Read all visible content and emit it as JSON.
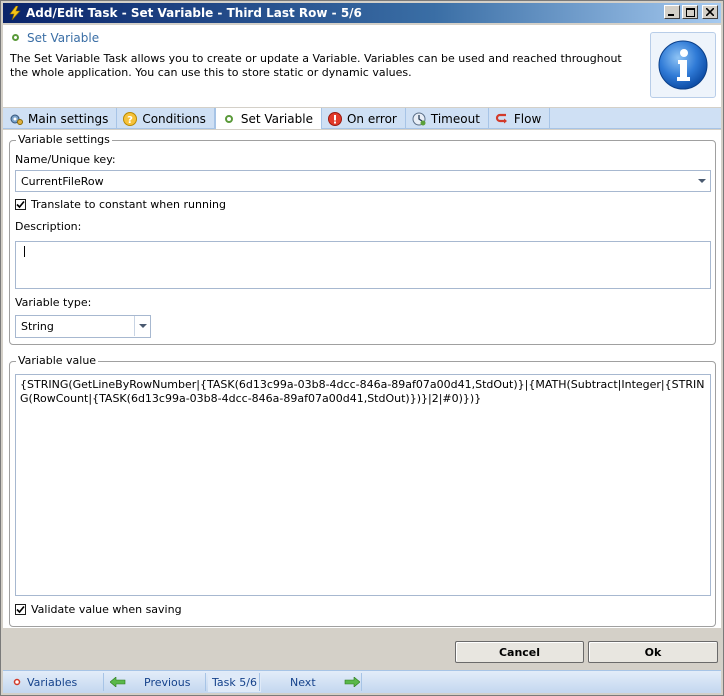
{
  "window": {
    "title": "Add/Edit Task - Set Variable - Third Last Row - 5/6",
    "controls": {
      "minimize": "_",
      "maximize": "□",
      "close": "✕"
    }
  },
  "header": {
    "title": "Set Variable",
    "description": "The Set Variable Task allows you to create or update a Variable. Variables can be used and reached throughout the whole application. You can use this to store static or dynamic values.",
    "icon": "info-icon"
  },
  "tabs": [
    {
      "label": "Main settings",
      "icon": "settings-icon",
      "active": false
    },
    {
      "label": "Conditions",
      "icon": "question-icon",
      "active": false
    },
    {
      "label": "Set Variable",
      "icon": "dot-icon",
      "active": true
    },
    {
      "label": "On error",
      "icon": "error-icon",
      "active": false
    },
    {
      "label": "Timeout",
      "icon": "timeout-icon",
      "active": false
    },
    {
      "label": "Flow",
      "icon": "flow-icon",
      "active": false
    }
  ],
  "variable_settings": {
    "legend": "Variable  settings",
    "name_label": "Name/Unique key:",
    "name_value": "CurrentFileRow",
    "translate_label": "Translate to constant when running",
    "translate_checked": true,
    "description_label": "Description:",
    "description_value": "",
    "type_label": "Variable type:",
    "type_value": "String"
  },
  "variable_value": {
    "legend": "Variable value",
    "value": "{STRING(GetLineByRowNumber|{TASK(6d13c99a-03b8-4dcc-846a-89af07a00d41,StdOut)}|{MATH(Subtract|Integer|{STRING(RowCount|{TASK(6d13c99a-03b8-4dcc-846a-89af07a00d41,StdOut)})}|2|#0)})}",
    "validate_label": "Validate value when saving",
    "validate_checked": true
  },
  "buttons": {
    "cancel": "Cancel",
    "ok": "Ok"
  },
  "nav": {
    "variables": "Variables",
    "previous": "Previous",
    "task": "Task 5/6",
    "next": "Next"
  },
  "colors": {
    "accent": "#3a6ea5",
    "tab_bar": "#cfe0f4",
    "titlebar": "#0a246a"
  }
}
